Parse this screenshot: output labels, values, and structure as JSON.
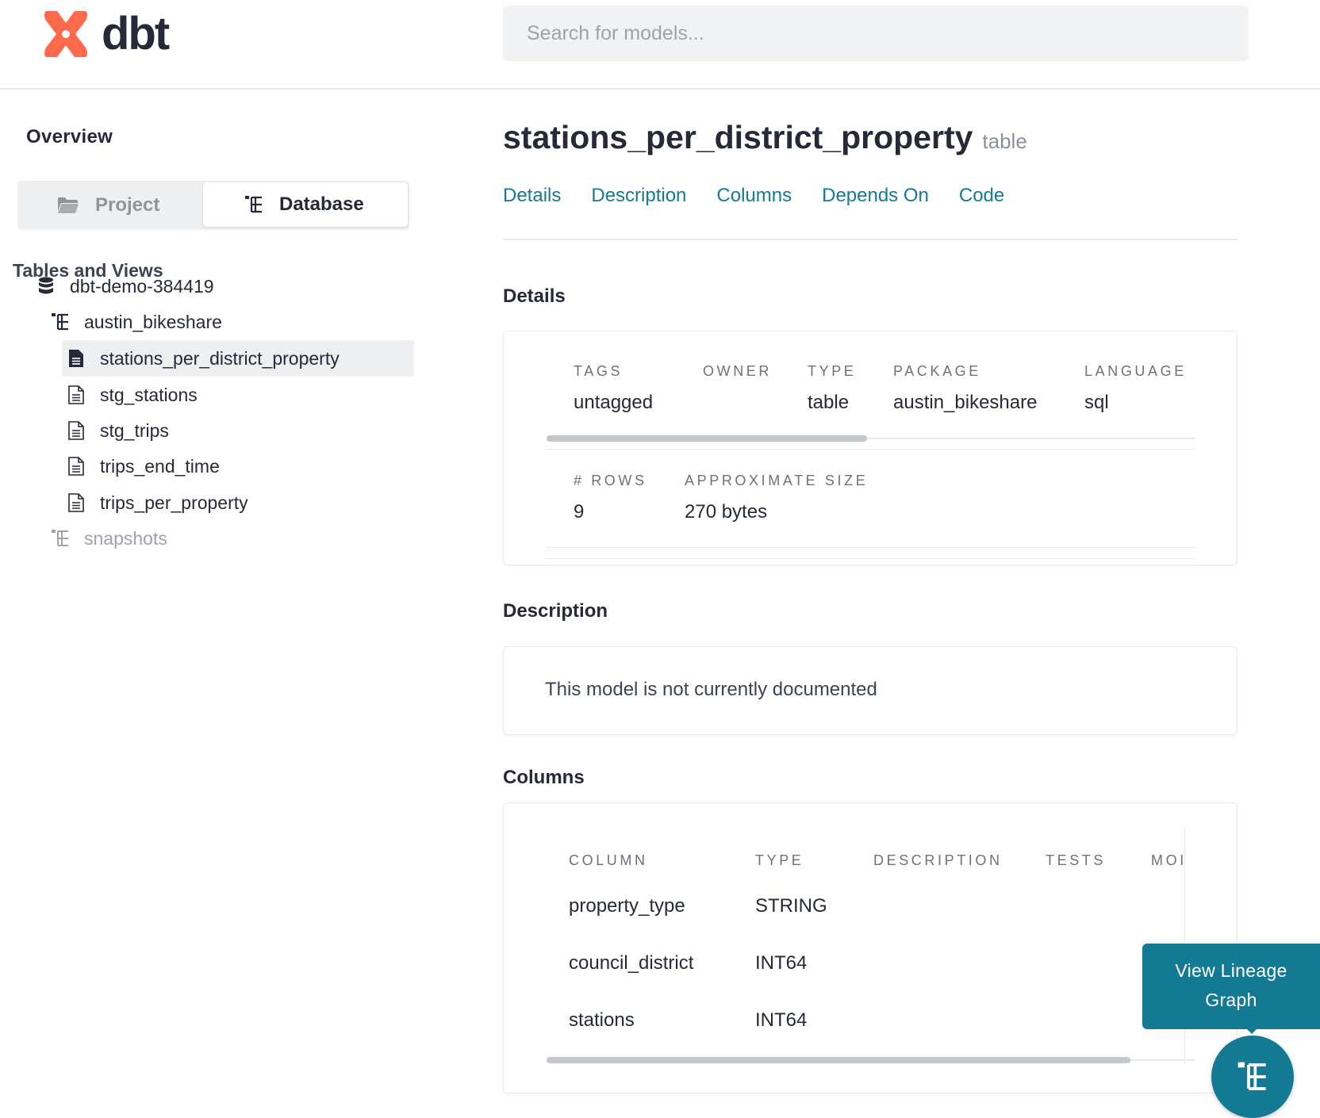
{
  "header": {
    "logo_text": "dbt",
    "search_placeholder": "Search for models..."
  },
  "sidebar": {
    "overview_label": "Overview",
    "toggle": {
      "project_label": "Project",
      "database_label": "Database",
      "selected": "Database"
    },
    "section_title": "Tables and Views",
    "tree": {
      "database": "dbt-demo-384419",
      "schemas": [
        {
          "name": "austin_bikeshare",
          "expanded": true,
          "items": [
            {
              "name": "stations_per_district_property",
              "active": true
            },
            {
              "name": "stg_stations",
              "active": false
            },
            {
              "name": "stg_trips",
              "active": false
            },
            {
              "name": "trips_end_time",
              "active": false
            },
            {
              "name": "trips_per_property",
              "active": false
            }
          ]
        },
        {
          "name": "snapshots",
          "expanded": false,
          "items": []
        }
      ]
    }
  },
  "main": {
    "model_name": "stations_per_district_property",
    "model_kind": "table",
    "tabs": [
      "Details",
      "Description",
      "Columns",
      "Depends On",
      "Code"
    ],
    "details": {
      "heading": "Details",
      "row1": [
        {
          "label": "TAGS",
          "value": "untagged"
        },
        {
          "label": "OWNER",
          "value": ""
        },
        {
          "label": "TYPE",
          "value": "table"
        },
        {
          "label": "PACKAGE",
          "value": "austin_bikeshare"
        },
        {
          "label": "LANGUAGE",
          "value": "sql"
        }
      ],
      "row2": [
        {
          "label": "# ROWS",
          "value": "9"
        },
        {
          "label": "APPROXIMATE SIZE",
          "value": "270 bytes"
        }
      ]
    },
    "description": {
      "heading": "Description",
      "text": "This model is not currently documented"
    },
    "columns": {
      "heading": "Columns",
      "headers": [
        "COLUMN",
        "TYPE",
        "DESCRIPTION",
        "TESTS",
        "MOI"
      ],
      "rows": [
        {
          "column": "property_type",
          "type": "STRING"
        },
        {
          "column": "council_district",
          "type": "INT64"
        },
        {
          "column": "stations",
          "type": "INT64"
        }
      ]
    }
  },
  "lineage": {
    "tooltip_line1": "View Lineage",
    "tooltip_line2": "Graph"
  },
  "colors": {
    "accent": "#147a94",
    "brand_orange": "#ff694b",
    "text": "#262a38"
  },
  "icons": {
    "project_toggle": "folder-open-icon",
    "database_toggle": "schema-tree-icon",
    "database_node": "database-icon",
    "schema_node": "schema-tree-icon",
    "model_active": "document-filled-icon",
    "model": "document-icon",
    "lineage_button": "lineage-tree-icon"
  }
}
